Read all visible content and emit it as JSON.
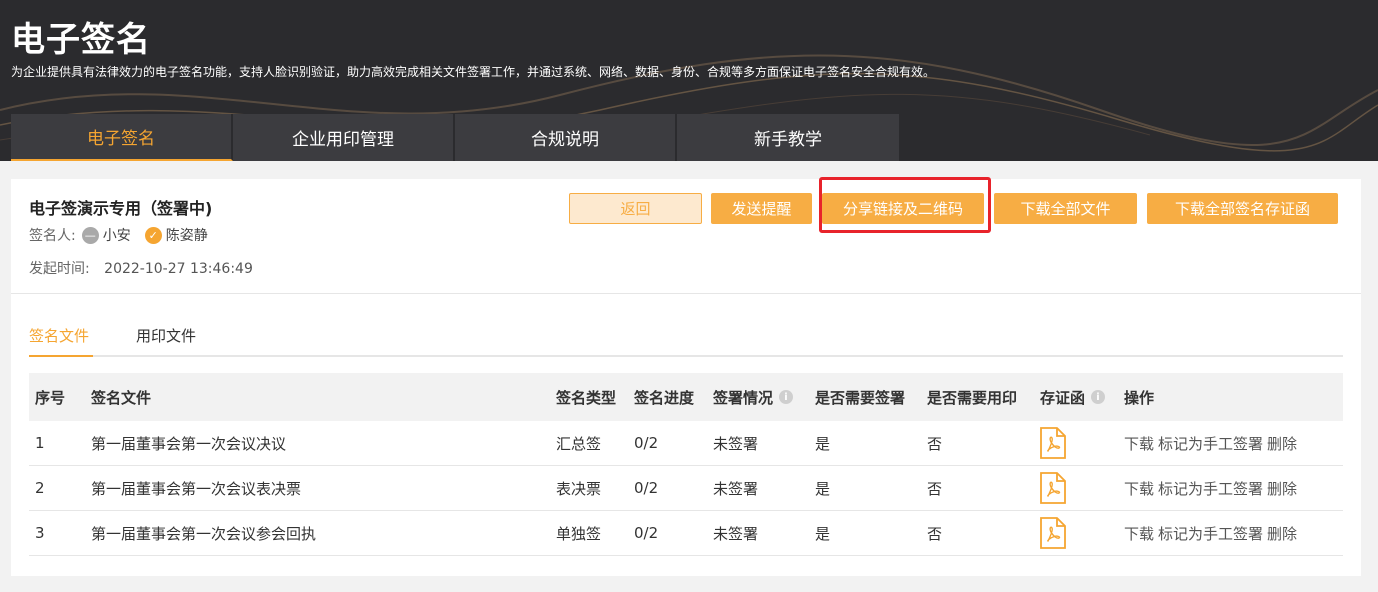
{
  "banner": {
    "title": "电子签名",
    "description": "为企业提供具有法律效力的电子签名功能，支持人脸识别验证，助力高效完成相关文件签署工作，并通过系统、网络、数据、身份、合规等多方面保证电子签名安全合规有效。"
  },
  "tabs": [
    {
      "label": "电子签名",
      "active": true
    },
    {
      "label": "企业用印管理",
      "active": false
    },
    {
      "label": "合规说明",
      "active": false
    },
    {
      "label": "新手教学",
      "active": false
    }
  ],
  "document": {
    "title": "电子签演示专用（签署中)",
    "signer_label": "签名人:",
    "signers": [
      {
        "name": "小安",
        "status_icon": "minus-circle-icon"
      },
      {
        "name": "陈姿静",
        "status_icon": "check-circle-icon"
      }
    ],
    "time_label": "发起时间:",
    "time_value": "2022-10-27 13:46:49"
  },
  "actions": {
    "back": "返回",
    "remind": "发送提醒",
    "share": "分享链接及二维码",
    "download_all": "下载全部文件",
    "download_certs": "下载全部签名存证函"
  },
  "subtabs": [
    {
      "label": "签名文件",
      "active": true
    },
    {
      "label": "用印文件",
      "active": false
    }
  ],
  "table": {
    "headers": {
      "index": "序号",
      "file": "签名文件",
      "type": "签名类型",
      "progress": "签名进度",
      "status": "签署情况",
      "need_sign": "是否需要签署",
      "need_seal": "是否需要用印",
      "cert": "存证函",
      "ops": "操作"
    },
    "rows": [
      {
        "index": "1",
        "file": "第一届董事会第一次会议决议",
        "type": "汇总签",
        "progress": "0/2",
        "status": "未签署",
        "need_sign": "是",
        "need_seal": "否"
      },
      {
        "index": "2",
        "file": "第一届董事会第一次会议表决票",
        "type": "表决票",
        "progress": "0/2",
        "status": "未签署",
        "need_sign": "是",
        "need_seal": "否"
      },
      {
        "index": "3",
        "file": "第一届董事会第一次会议参会回执",
        "type": "单独签",
        "progress": "0/2",
        "status": "未签署",
        "need_sign": "是",
        "need_seal": "否"
      }
    ],
    "row_actions": {
      "download": "下载",
      "mark_manual": "标记为手工签署",
      "delete": "删除"
    },
    "info_icon_glyph": "i"
  },
  "colors": {
    "accent": "#f5a531",
    "highlight": "#e8232b",
    "banner_bg": "#2b2b2e"
  }
}
